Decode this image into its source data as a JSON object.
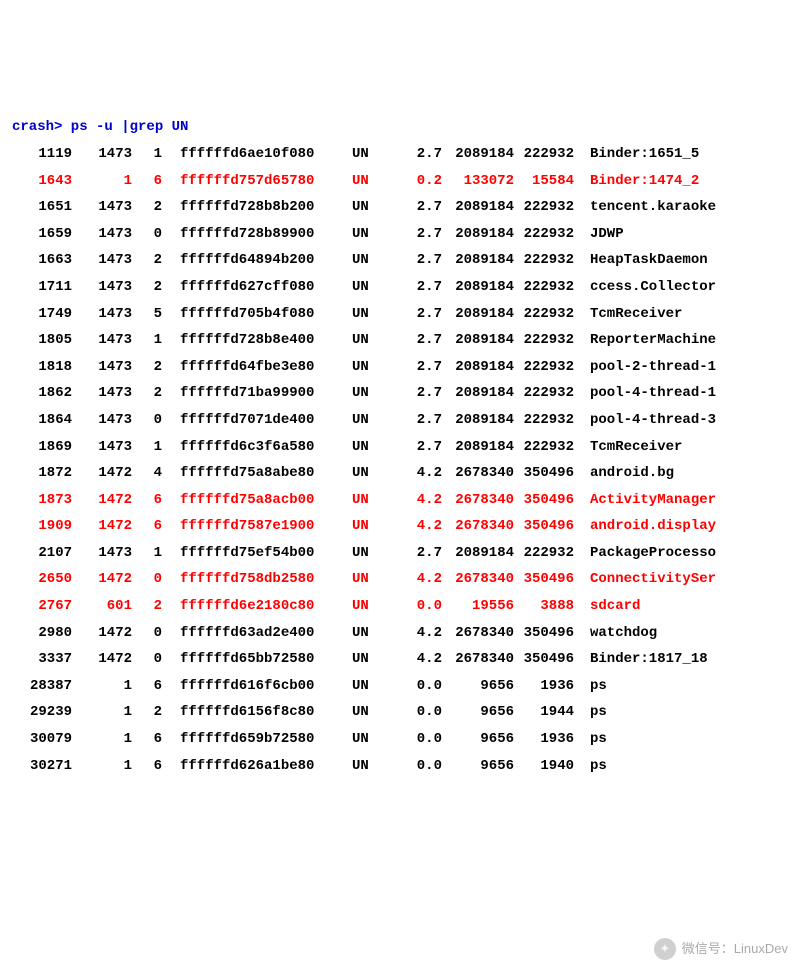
{
  "prompt": {
    "shell": "crash>",
    "command": "ps -u |grep UN"
  },
  "rows": [
    {
      "pid": "1119",
      "ppid": "1473",
      "cpu": "1",
      "task": "ffffffd6ae10f080",
      "st": "UN",
      "mem": "2.7",
      "vsz": "2089184",
      "rss": "222932",
      "comm": "Binder:1651_5",
      "hl": false
    },
    {
      "pid": "1643",
      "ppid": "1",
      "cpu": "6",
      "task": "ffffffd757d65780",
      "st": "UN",
      "mem": "0.2",
      "vsz": "133072",
      "rss": "15584",
      "comm": "Binder:1474_2",
      "hl": true
    },
    {
      "pid": "1651",
      "ppid": "1473",
      "cpu": "2",
      "task": "ffffffd728b8b200",
      "st": "UN",
      "mem": "2.7",
      "vsz": "2089184",
      "rss": "222932",
      "comm": "tencent.karaoke",
      "hl": false
    },
    {
      "pid": "1659",
      "ppid": "1473",
      "cpu": "0",
      "task": "ffffffd728b89900",
      "st": "UN",
      "mem": "2.7",
      "vsz": "2089184",
      "rss": "222932",
      "comm": "JDWP",
      "hl": false
    },
    {
      "pid": "1663",
      "ppid": "1473",
      "cpu": "2",
      "task": "ffffffd64894b200",
      "st": "UN",
      "mem": "2.7",
      "vsz": "2089184",
      "rss": "222932",
      "comm": "HeapTaskDaemon",
      "hl": false
    },
    {
      "pid": "1711",
      "ppid": "1473",
      "cpu": "2",
      "task": "ffffffd627cff080",
      "st": "UN",
      "mem": "2.7",
      "vsz": "2089184",
      "rss": "222932",
      "comm": "ccess.Collector",
      "hl": false
    },
    {
      "pid": "1749",
      "ppid": "1473",
      "cpu": "5",
      "task": "ffffffd705b4f080",
      "st": "UN",
      "mem": "2.7",
      "vsz": "2089184",
      "rss": "222932",
      "comm": "TcmReceiver",
      "hl": false
    },
    {
      "pid": "1805",
      "ppid": "1473",
      "cpu": "1",
      "task": "ffffffd728b8e400",
      "st": "UN",
      "mem": "2.7",
      "vsz": "2089184",
      "rss": "222932",
      "comm": "ReporterMachine",
      "hl": false
    },
    {
      "pid": "1818",
      "ppid": "1473",
      "cpu": "2",
      "task": "ffffffd64fbe3e80",
      "st": "UN",
      "mem": "2.7",
      "vsz": "2089184",
      "rss": "222932",
      "comm": "pool-2-thread-1",
      "hl": false
    },
    {
      "pid": "1862",
      "ppid": "1473",
      "cpu": "2",
      "task": "ffffffd71ba99900",
      "st": "UN",
      "mem": "2.7",
      "vsz": "2089184",
      "rss": "222932",
      "comm": "pool-4-thread-1",
      "hl": false
    },
    {
      "pid": "1864",
      "ppid": "1473",
      "cpu": "0",
      "task": "ffffffd7071de400",
      "st": "UN",
      "mem": "2.7",
      "vsz": "2089184",
      "rss": "222932",
      "comm": "pool-4-thread-3",
      "hl": false
    },
    {
      "pid": "1869",
      "ppid": "1473",
      "cpu": "1",
      "task": "ffffffd6c3f6a580",
      "st": "UN",
      "mem": "2.7",
      "vsz": "2089184",
      "rss": "222932",
      "comm": "TcmReceiver",
      "hl": false
    },
    {
      "pid": "1872",
      "ppid": "1472",
      "cpu": "4",
      "task": "ffffffd75a8abe80",
      "st": "UN",
      "mem": "4.2",
      "vsz": "2678340",
      "rss": "350496",
      "comm": "android.bg",
      "hl": false
    },
    {
      "pid": "1873",
      "ppid": "1472",
      "cpu": "6",
      "task": "ffffffd75a8acb00",
      "st": "UN",
      "mem": "4.2",
      "vsz": "2678340",
      "rss": "350496",
      "comm": "ActivityManager",
      "hl": true
    },
    {
      "pid": "1909",
      "ppid": "1472",
      "cpu": "6",
      "task": "ffffffd7587e1900",
      "st": "UN",
      "mem": "4.2",
      "vsz": "2678340",
      "rss": "350496",
      "comm": "android.display",
      "hl": true
    },
    {
      "pid": "2107",
      "ppid": "1473",
      "cpu": "1",
      "task": "ffffffd75ef54b00",
      "st": "UN",
      "mem": "2.7",
      "vsz": "2089184",
      "rss": "222932",
      "comm": "PackageProcesso",
      "hl": false
    },
    {
      "pid": "2650",
      "ppid": "1472",
      "cpu": "0",
      "task": "ffffffd758db2580",
      "st": "UN",
      "mem": "4.2",
      "vsz": "2678340",
      "rss": "350496",
      "comm": "ConnectivitySer",
      "hl": true
    },
    {
      "pid": "2767",
      "ppid": "601",
      "cpu": "2",
      "task": "ffffffd6e2180c80",
      "st": "UN",
      "mem": "0.0",
      "vsz": "19556",
      "rss": "3888",
      "comm": "sdcard",
      "hl": true
    },
    {
      "pid": "2980",
      "ppid": "1472",
      "cpu": "0",
      "task": "ffffffd63ad2e400",
      "st": "UN",
      "mem": "4.2",
      "vsz": "2678340",
      "rss": "350496",
      "comm": "watchdog",
      "hl": false
    },
    {
      "pid": "3337",
      "ppid": "1472",
      "cpu": "0",
      "task": "ffffffd65bb72580",
      "st": "UN",
      "mem": "4.2",
      "vsz": "2678340",
      "rss": "350496",
      "comm": "Binder:1817_18",
      "hl": false
    },
    {
      "pid": "28387",
      "ppid": "1",
      "cpu": "6",
      "task": "ffffffd616f6cb00",
      "st": "UN",
      "mem": "0.0",
      "vsz": "9656",
      "rss": "1936",
      "comm": "ps",
      "hl": false
    },
    {
      "pid": "29239",
      "ppid": "1",
      "cpu": "2",
      "task": "ffffffd6156f8c80",
      "st": "UN",
      "mem": "0.0",
      "vsz": "9656",
      "rss": "1944",
      "comm": "ps",
      "hl": false
    },
    {
      "pid": "30079",
      "ppid": "1",
      "cpu": "6",
      "task": "ffffffd659b72580",
      "st": "UN",
      "mem": "0.0",
      "vsz": "9656",
      "rss": "1936",
      "comm": "ps",
      "hl": false
    },
    {
      "pid": "30271",
      "ppid": "1",
      "cpu": "6",
      "task": "ffffffd626a1be80",
      "st": "UN",
      "mem": "0.0",
      "vsz": "9656",
      "rss": "1940",
      "comm": "ps",
      "hl": false
    }
  ],
  "watermark": {
    "label": "微信号：LinuxDev"
  }
}
